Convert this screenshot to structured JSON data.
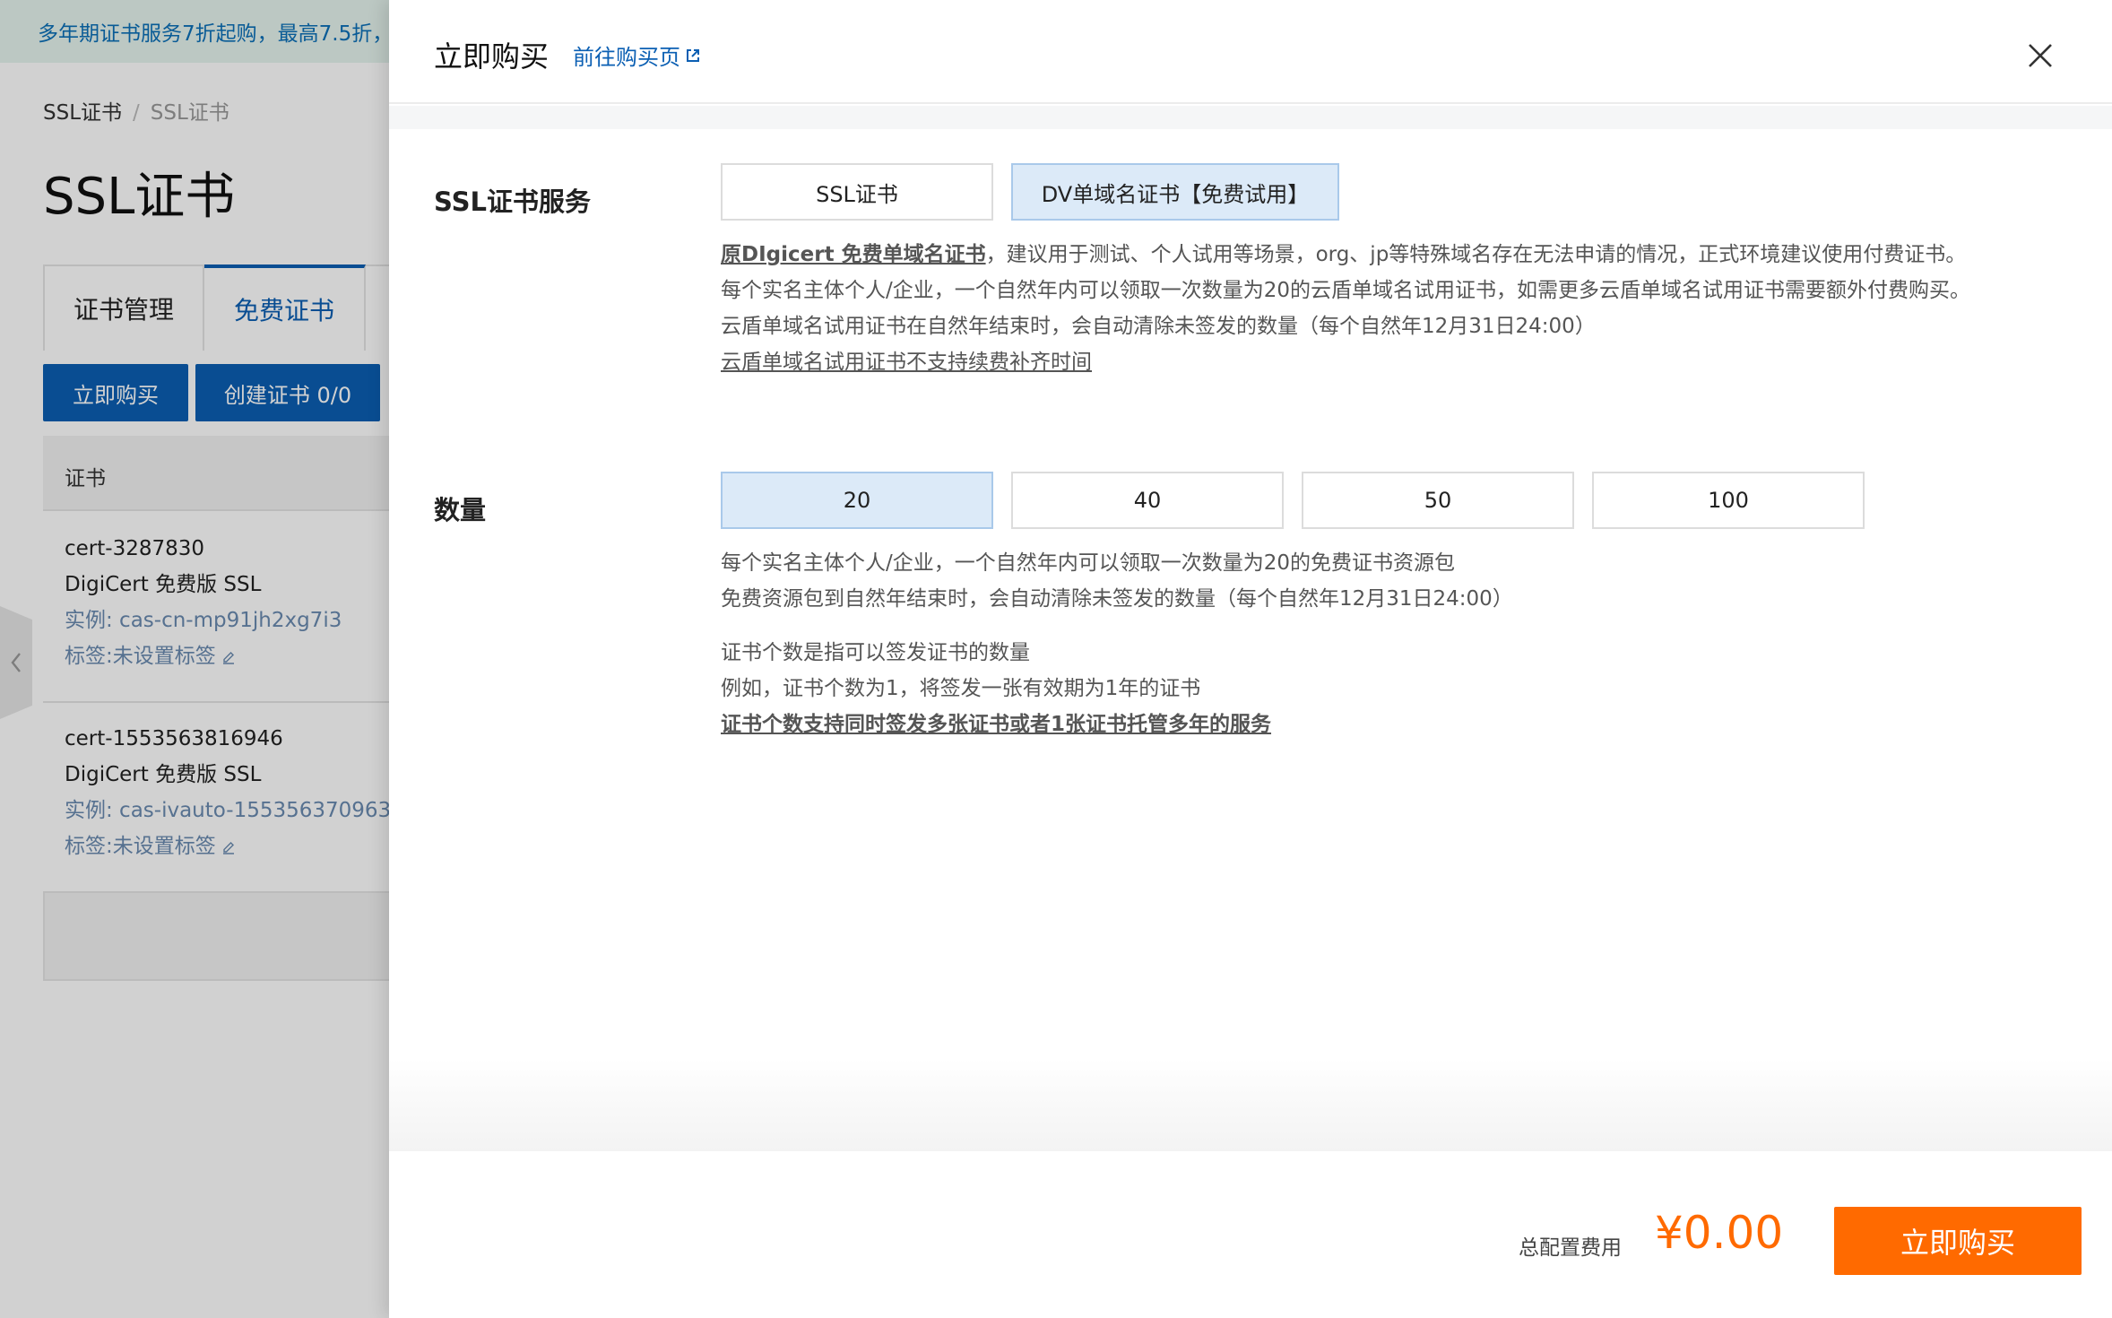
{
  "colors": {
    "primary": "#0b5fb3",
    "accent_orange": "#ff6a00",
    "selected_option_bg": "#dceaf8",
    "promo_bg": "#e6f4ee"
  },
  "background": {
    "promo": "多年期证书服务7折起购，最高7.5折，",
    "breadcrumb": [
      "SSL证书",
      "SSL证书"
    ],
    "page_title": "SSL证书",
    "tabs": [
      {
        "label": "证书管理",
        "active": false
      },
      {
        "label": "免费证书",
        "active": true
      }
    ],
    "buttons": {
      "buy": "立即购买",
      "create": "创建证书 0/0"
    },
    "table_header": "证书",
    "certs": [
      {
        "name": "cert-3287830",
        "product": "DigiCert 免费版 SSL",
        "instance": "实例: cas-cn-mp91jh2xg7i3",
        "tag": "标签:未设置标签"
      },
      {
        "name": "cert-1553563816946",
        "product": "DigiCert 免费版 SSL",
        "instance": "实例: cas-ivauto-155356370963",
        "tag": "标签:未设置标签"
      }
    ]
  },
  "drawer": {
    "title": "立即购买",
    "link": "前往购买页",
    "service": {
      "label": "SSL证书服务",
      "options": [
        {
          "label": "SSL证书",
          "selected": false
        },
        {
          "label": "DV单域名证书【免费试用】",
          "selected": true
        }
      ],
      "desc": {
        "line1_link": "原DIgicert 免费单域名证书",
        "line1_rest": "，建议用于测试、个人试用等场景，org、jp等特殊域名存在无法申请的情况，正式环境建议使用付费证书。",
        "line2": "每个实名主体个人/企业，一个自然年内可以领取一次数量为20的云盾单域名试用证书，如需更多云盾单域名试用证书需要额外付费购买。",
        "line3": "云盾单域名试用证书在自然年结束时，会自动清除未签发的数量（每个自然年12月31日24:00）",
        "line4_link": "云盾单域名试用证书不支持续费补齐时间"
      }
    },
    "quantity": {
      "label": "数量",
      "options": [
        {
          "label": "20",
          "selected": true
        },
        {
          "label": "40",
          "selected": false
        },
        {
          "label": "50",
          "selected": false
        },
        {
          "label": "100",
          "selected": false
        }
      ],
      "desc": {
        "line1": "每个实名主体个人/企业，一个自然年内可以领取一次数量为20的免费证书资源包",
        "line2": "免费资源包到自然年结束时，会自动清除未签发的数量（每个自然年12月31日24:00）",
        "line3": "证书个数是指可以签发证书的数量",
        "line4": "例如，证书个数为1，将签发一张有效期为1年的证书",
        "line5_link": "证书个数支持同时签发多张证书或者1张证书托管多年的服务"
      }
    },
    "footer": {
      "fee_label": "总配置费用",
      "fee_value": "¥0.00",
      "buy_button": "立即购买"
    }
  }
}
